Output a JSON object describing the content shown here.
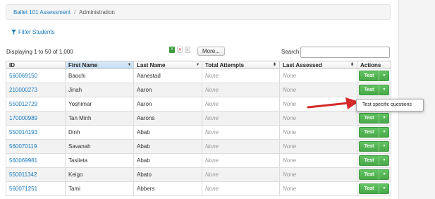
{
  "breadcrumb": {
    "course": "Ballet 101 Assessment",
    "separator": "/",
    "current": "Administration"
  },
  "filter": {
    "label": "Filter Students",
    "icon": "funnel-icon"
  },
  "listing": {
    "display_text": "Displaying 1 to 50 of 1,000",
    "more_label": "More...",
    "search_label": "Search",
    "search_value": "",
    "export_icons": [
      "excel-icon",
      "pdf-icon",
      "print-icon"
    ]
  },
  "table": {
    "headers": [
      {
        "label": "ID",
        "sort": ""
      },
      {
        "label": "First Name",
        "sort": "▾"
      },
      {
        "label": "Last Name",
        "sort": "▾"
      },
      {
        "label": "Total Attempts",
        "sort": "⬍"
      },
      {
        "label": "Last Assessed",
        "sort": "⬍"
      },
      {
        "label": "Actions",
        "sort": ""
      }
    ],
    "rows": [
      {
        "id": "560069150",
        "first": "Baochi",
        "last": "Aanestad",
        "attempts": "None",
        "assessed": "None",
        "action": "Test"
      },
      {
        "id": "210000273",
        "first": "Jinah",
        "last": "Aaron",
        "attempts": "None",
        "assessed": "None",
        "action": "Test"
      },
      {
        "id": "550012729",
        "first": "Yoshimar",
        "last": "Aaron",
        "attempts": "None",
        "assessed": "None",
        "action": "Test"
      },
      {
        "id": "170000989",
        "first": "Tan Minh",
        "last": "Aarons",
        "attempts": "None",
        "assessed": "None",
        "action": "Test"
      },
      {
        "id": "550014193",
        "first": "Dinh",
        "last": "Abab",
        "attempts": "None",
        "assessed": "None",
        "action": "Test"
      },
      {
        "id": "560070119",
        "first": "Savanah",
        "last": "Abab",
        "attempts": "None",
        "assessed": "None",
        "action": "Test"
      },
      {
        "id": "560069981",
        "first": "Tasileta",
        "last": "Abab",
        "attempts": "None",
        "assessed": "None",
        "action": "Test"
      },
      {
        "id": "550011342",
        "first": "Keigo",
        "last": "Abato",
        "attempts": "None",
        "assessed": "None",
        "action": "Test"
      },
      {
        "id": "560071251",
        "first": "Tami",
        "last": "Abbers",
        "attempts": "None",
        "assessed": "None",
        "action": "Test"
      }
    ]
  },
  "tooltip": {
    "text": "Test specific questions"
  },
  "colors": {
    "link": "#1a7bbf",
    "button_green": "#4aa94a",
    "annotation_arrow": "#d42a2a"
  }
}
